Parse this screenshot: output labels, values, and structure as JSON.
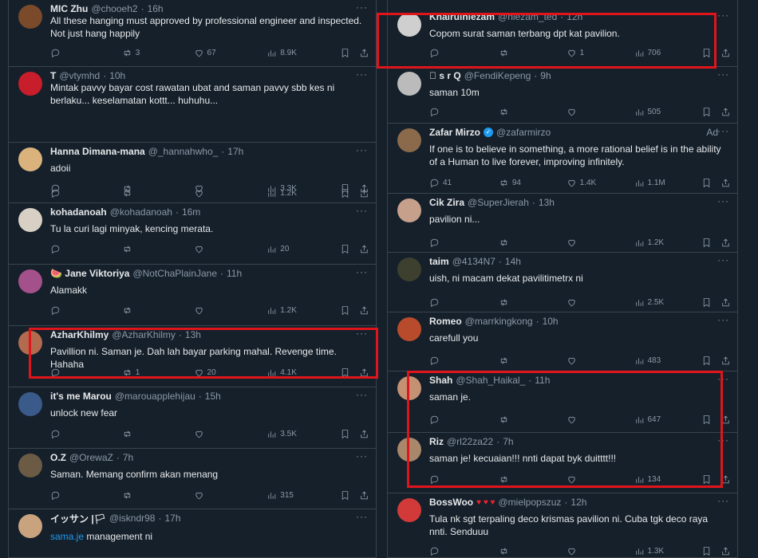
{
  "left": [
    {
      "name": "MIC Zhu",
      "handle": "@chooeh2",
      "time": "16h",
      "text": "All these hanging must approved by professional engineer and inspected. Not just hang happily",
      "replies": "",
      "retweets": "3",
      "likes": "67",
      "views": "8.9K",
      "avatar_color": "#7a4a2a"
    },
    {
      "name": "T",
      "handle": "@vtymhd",
      "time": "10h",
      "text": "Mintak pavvy bayar cost rawatan ubat and saman pavvy sbb kes ni berlaku... keselamatan kottt... huhuhu...",
      "replies": "",
      "retweets": "",
      "likes": "",
      "views": "1.2K",
      "avatar_color": "#c81d2a"
    },
    {
      "name": "Hanna Dimana-mana",
      "handle": "@_hannahwho_",
      "time": "17h",
      "text": "adoii",
      "replies": "",
      "retweets": "",
      "likes": "",
      "views": "3.3K",
      "avatar_color": "#d9b27c"
    },
    {
      "name": "kohadanoah",
      "handle": "@kohadanoah",
      "time": "16m",
      "text": "Tu la curi lagi minyak, kencing merata.",
      "replies": "",
      "retweets": "",
      "likes": "",
      "views": "20",
      "avatar_color": "#d8d0c4"
    },
    {
      "name": "🍉 Jane Viktoriya",
      "handle": "@NotChaPlainJane",
      "time": "11h",
      "text": "Alamakk",
      "replies": "",
      "retweets": "",
      "likes": "",
      "views": "1.2K",
      "avatar_color": "#a4508b"
    },
    {
      "name": "AzharKhilmy",
      "handle": "@AzharKhilmy",
      "time": "13h",
      "text": "Pavillion ni. Saman je. Dah lah bayar parking mahal. Revenge time. Hahaha",
      "replies": "",
      "retweets": "1",
      "likes": "20",
      "views": "4.1K",
      "avatar_color": "#b36b4f"
    },
    {
      "name": "it's me Marou",
      "handle": "@marouapplehijau",
      "time": "15h",
      "text": "unlock new fear",
      "replies": "",
      "retweets": "",
      "likes": "",
      "views": "3.5K",
      "avatar_color": "#3a5a8a"
    },
    {
      "name": "O.Z",
      "handle": "@OrewaZ",
      "time": "7h",
      "text": "Saman. Memang confirm akan menang",
      "replies": "",
      "retweets": "",
      "likes": "",
      "views": "315",
      "avatar_color": "#6b5a44"
    },
    {
      "name": "イッサン |🏳",
      "handle": "@iskndr98",
      "time": "17h",
      "link": "sama.je",
      "text": " management ni",
      "replies": "",
      "retweets": "",
      "likes": "",
      "views": "",
      "avatar_color": "#c9a37e"
    }
  ],
  "right": [
    {
      "name": "Khairulniezam",
      "handle": "@niezam_ted",
      "time": "12h",
      "text": "Copom surat saman terbang dpt kat pavilion.",
      "replies": "",
      "retweets": "",
      "likes": "1",
      "views": "706",
      "avatar_color": "#cfcfcf"
    },
    {
      "name": " s r Q",
      "handle": "@FendiKepeng",
      "time": "9h",
      "text": "saman 10m",
      "replies": "",
      "retweets": "",
      "likes": "",
      "views": "505",
      "avatar_color": "#bbbbbb"
    },
    {
      "name": "Zafar Mirzo",
      "handle": "@zafarmirzo",
      "time": "",
      "ad": "Ad",
      "text": "If one is to believe in something, a more rational belief is in the ability of a Human to live forever, improving infinitely.",
      "replies": "41",
      "retweets": "94",
      "likes": "1.4K",
      "views": "1.1M",
      "avatar_color": "#8a6a4a"
    },
    {
      "name": "Cik Zira",
      "handle": "@SuperJierah",
      "time": "13h",
      "text": "pavilion ni...",
      "replies": "",
      "retweets": "",
      "likes": "",
      "views": "1.2K",
      "avatar_color": "#c7a08c"
    },
    {
      "name": "taim",
      "handle": "@4134N7",
      "time": "14h",
      "text": "uish, ni macam dekat pavilitimetrx ni",
      "replies": "",
      "retweets": "",
      "likes": "",
      "views": "2.5K",
      "avatar_color": "#3d3f2f"
    },
    {
      "name": "Romeo",
      "handle": "@marrkingkong",
      "time": "10h",
      "text": "carefull you",
      "replies": "",
      "retweets": "",
      "likes": "",
      "views": "483",
      "avatar_color": "#b84b2b"
    },
    {
      "name": "Shah",
      "handle": "@Shah_Haikal_",
      "time": "11h",
      "text": "saman je.",
      "replies": "",
      "retweets": "",
      "likes": "",
      "views": "647",
      "avatar_color": "#c49273"
    },
    {
      "name": "Riz",
      "handle": "@rl22za22",
      "time": "7h",
      "text": "saman je! kecuaian!!! nnti dapat byk duitttt!!!",
      "replies": "",
      "retweets": "",
      "likes": "",
      "views": "134",
      "avatar_color": "#a9876a"
    },
    {
      "name": "BossWoo",
      "hearts": "♥ ♥ ♥",
      "handle": "@mielpopszuz",
      "time": "12h",
      "text": "Tula nk sgt terpaling deco krismas pavilion ni. Cuba tgk deco raya nnti. Senduuu",
      "replies": "",
      "retweets": "",
      "likes": "",
      "views": "1.3K",
      "avatar_color": "#d23a3a"
    }
  ],
  "ui": {
    "more_glyph": "···",
    "dot": "·",
    "highlight_color": "#e0151b",
    "accent": "#1d9bf0",
    "background": "#15202b"
  }
}
